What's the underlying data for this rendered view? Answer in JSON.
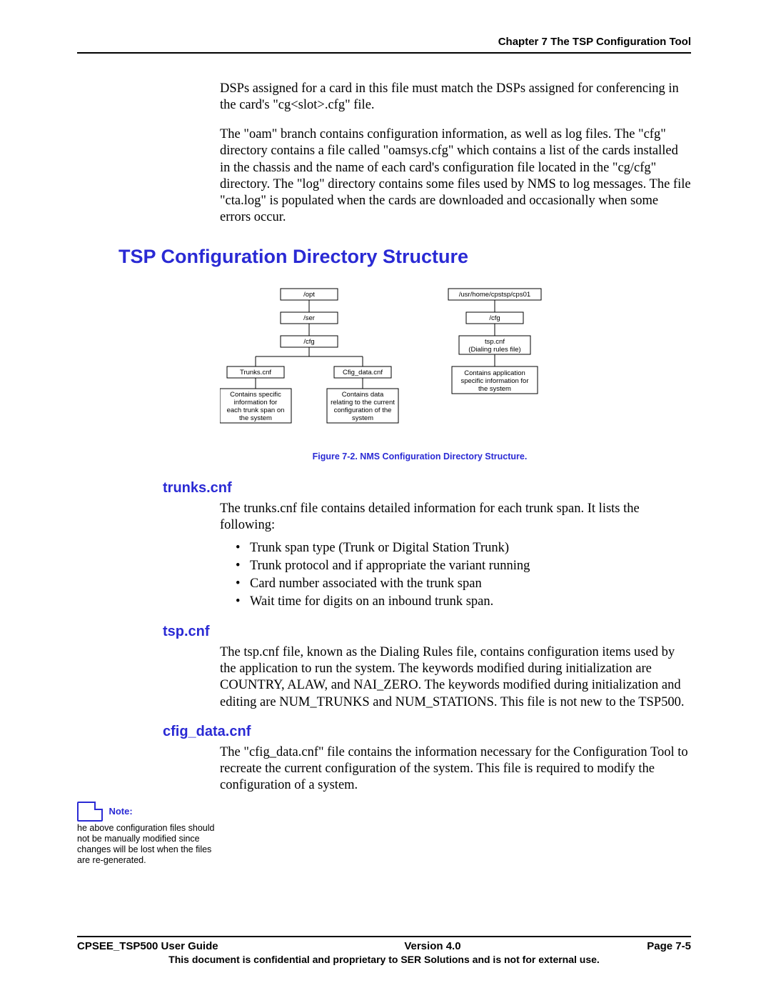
{
  "header": {
    "chapter": "Chapter 7 The TSP Configuration Tool"
  },
  "intro": {
    "p1": "DSPs assigned for a card in this file must match the DSPs assigned for conferencing in the card's \"cg<slot>.cfg\" file.",
    "p2": "The \"oam\" branch contains configuration information, as well as log files. The \"cfg\" directory contains a file called \"oamsys.cfg\" which contains a list of the cards installed in the chassis and the name of each card's configuration file located in the \"cg/cfg\" directory. The \"log\" directory contains some files used by NMS to log messages. The file \"cta.log\" is populated when the cards are downloaded and occasionally when some errors occur."
  },
  "h1": "TSP Configuration Directory Structure",
  "figure": {
    "caption": "Figure 7-2. NMS Configuration Directory Structure.",
    "nodes": {
      "opt": "/opt",
      "ser": "/ser",
      "cfg": "/cfg",
      "trunks": "Trunks.cnf",
      "trunks_desc": [
        "Contains specific",
        "information for",
        "each trunk span on",
        "the system"
      ],
      "cfig": "Cfig_data.cnf",
      "cfig_desc": [
        "Contains data",
        "relating to the current",
        "configuration of the",
        "system"
      ],
      "home": "/usr/home/cpstsp/cps01",
      "cfg2": "/cfg",
      "tsp": [
        "tsp.cnf",
        "(Dialing rules file)"
      ],
      "tsp_desc": [
        "Contains application",
        "specific information for",
        "the system"
      ]
    }
  },
  "trunks": {
    "h": "trunks.cnf",
    "p": "The trunks.cnf file contains detailed information for each trunk span.  It lists the following:",
    "items": [
      "Trunk span type (Trunk or Digital Station Trunk)",
      "Trunk protocol and if appropriate the variant running",
      "Card number associated with the trunk span",
      "Wait time for digits on an inbound trunk span."
    ]
  },
  "tsp": {
    "h": "tsp.cnf",
    "p": "The tsp.cnf file, known as the Dialing Rules file, contains configuration items used by the application to run the system. The keywords modified during initialization are COUNTRY, ALAW, and NAI_ZERO.  The keywords modified during initialization and editing are NUM_TRUNKS and NUM_STATIONS. This file is not new to the TSP500."
  },
  "cfig": {
    "h": "cfig_data.cnf",
    "p": "The \"cfig_data.cnf\" file contains the information necessary for the Configuration Tool to recreate the current configuration of the system.  This file is required to modify the configuration of a system."
  },
  "note": {
    "label": "Note:",
    "body": "he above configuration files should not be manually modified since changes will be lost when the files are re-generated."
  },
  "footer": {
    "left": "CPSEE_TSP500 User Guide",
    "center": "Version 4.0",
    "right": "Page 7-5",
    "conf": "This document is confidential and proprietary to SER Solutions and is not for external use."
  }
}
